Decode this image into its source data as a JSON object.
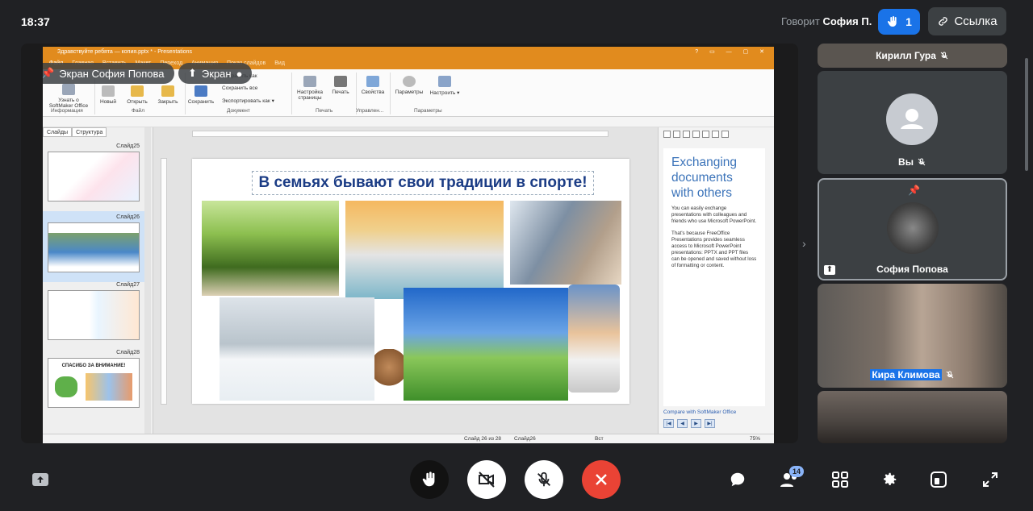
{
  "top_bar": {
    "clock": "18:37",
    "speaking_label": "Говорит",
    "speaking_name": "София П.",
    "raised_hands": "1",
    "link_label": "Ссылка"
  },
  "screen_overlay": {
    "pinned_label": "Экран София Попова",
    "screen_label": "Экран"
  },
  "app": {
    "title": "Здравствуйте ребята — копия.pptx * - Presentations",
    "tabs": [
      "Файл",
      "Главная",
      "Вставить",
      "Макет",
      "Переход",
      "Анимация",
      "Показ слайдов",
      "Вид"
    ],
    "ribbon": {
      "about_label": "Узнать о SoftMaker Office",
      "info_group": "Информация",
      "new_label": "Новый",
      "open_label": "Открыть",
      "close_label": "Закрыть",
      "file_group": "Файл",
      "save_label": "Сохранить",
      "save_as_label": "Сохранить как",
      "save_all_label": "Сохранить все",
      "export_label": "Экспортировать как",
      "document_group": "Документ",
      "page_setup_label": "Настройка страницы",
      "print_label": "Печать",
      "print_group": "Печать",
      "properties_label": "Свойства",
      "manage_group": "Управлен...",
      "params_label": "Параметры",
      "customize_label": "Настроить",
      "params_group": "Параметры"
    },
    "slides_pane": {
      "tab_slides": "Слайды",
      "tab_structure": "Структура",
      "labels": [
        "Слайд25",
        "Слайд26",
        "Слайд27",
        "Слайд28"
      ],
      "thumb28_text": "СПАСИБО ЗА ВНИМАНИЕ!"
    },
    "slide": {
      "title": "В семьях бывают свои традиции в спорте!"
    },
    "side_pane": {
      "heading": "Exchanging documents with others",
      "para1": "You can easily exchange presentations with colleagues and friends who use Microsoft PowerPoint.",
      "para2": "That's because FreeOffice Presentations provides seamless access to Microsoft PowerPoint presentations: PPTX and PPT files can be opened and saved without loss of formatting or content.",
      "compare_link": "Compare with SoftMaker Office"
    },
    "status": {
      "slide_pos": "Слайд 26 из 28",
      "slide_name": "Слайд26",
      "mode": "Вст",
      "zoom": "75%"
    }
  },
  "participants": [
    {
      "name": "Кирилл Гура",
      "muted": true
    },
    {
      "name": "Вы",
      "muted": true
    },
    {
      "name": "София Попова",
      "pinned": true
    },
    {
      "name": "Кира Климова",
      "muted": true
    },
    {
      "name": ""
    }
  ],
  "bottom_bar": {
    "people_count": "14"
  },
  "colors": {
    "background": "#202124",
    "accent": "#1a73e8",
    "end_call": "#ea4335",
    "app_orange": "#e18b1e",
    "slide_title": "#1b3c85"
  }
}
